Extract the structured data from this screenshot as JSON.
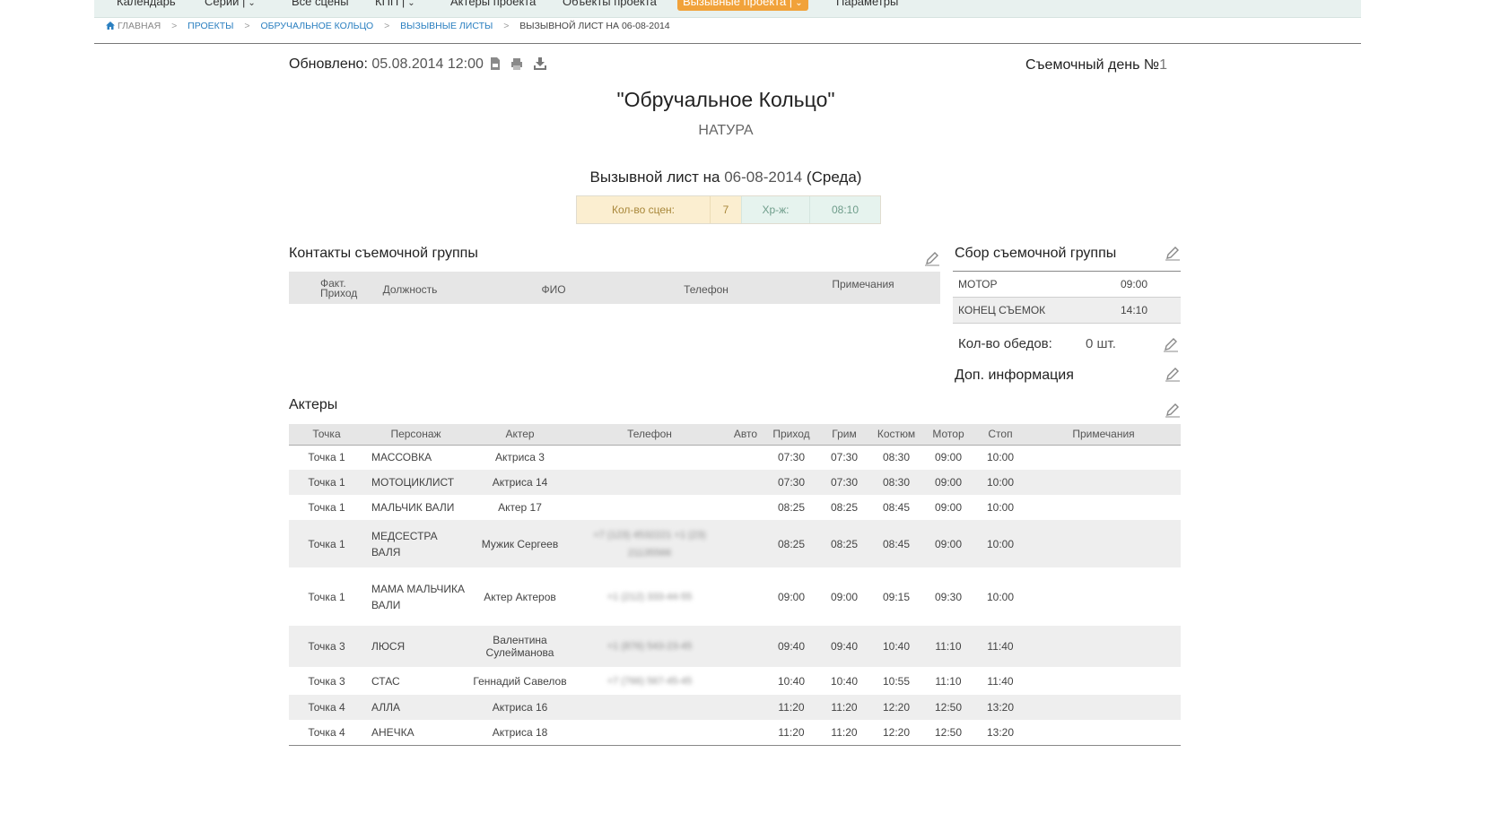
{
  "nav": [
    {
      "label": "Календарь",
      "chevron": false,
      "active": false
    },
    {
      "label": "Серии |",
      "chevron": true,
      "active": false
    },
    {
      "label": "Все сцены",
      "chevron": false,
      "active": false
    },
    {
      "label": "КПП |",
      "chevron": true,
      "active": false
    },
    {
      "label": "Актеры проекта",
      "chevron": false,
      "active": false
    },
    {
      "label": "Объекты проекта",
      "chevron": false,
      "active": false
    },
    {
      "label": "Вызывные проекта |",
      "chevron": true,
      "active": true
    },
    {
      "label": "Параметры",
      "chevron": false,
      "active": false
    }
  ],
  "breadcrumb": {
    "home": "ГЛАВНАЯ",
    "projects": "ПРОЕКТЫ",
    "project": "ОБРУЧАЛЬНОЕ КОЛЬЦО",
    "sheets": "ВЫЗЫВНЫЕ ЛИСТЫ",
    "current": "ВЫЗЫВНОЙ ЛИСТ НА 06-08-2014"
  },
  "header": {
    "updated_label": "Обновлено:",
    "updated_value": "05.08.2014 12:00",
    "shoot_day_label": "Съемочный день №",
    "shoot_day_num": "1",
    "project_title": "\"Обручальное Кольцо\"",
    "project_subtitle": "НАТУРА",
    "sheet_label": "Вызывной лист на",
    "sheet_date": "06-08-2014",
    "sheet_open_paren": "(",
    "sheet_day": "Среда",
    "sheet_close_paren": ")"
  },
  "stats": {
    "scenes_label": "Кол-во сцен:",
    "scenes_value": "7",
    "duration_label": "Хр-ж:",
    "duration_value": "08:10"
  },
  "contacts": {
    "title": "Контакты съемочной группы",
    "col_arrival_1": "Факт.",
    "col_arrival_2": "Приход",
    "col_position": "Должность",
    "col_name": "ФИО",
    "col_phone": "Телефон",
    "col_notes": "Примечания"
  },
  "crew_call": {
    "title": "Сбор съемочной группы",
    "rows": [
      {
        "label": "МОТОР",
        "time": "09:00"
      },
      {
        "label": "КОНЕЦ СЪЕМОК",
        "time": "14:10"
      }
    ],
    "lunch_label": "Кол-во обедов:",
    "lunch_value": "0 шт.",
    "extra_info": "Доп. информация"
  },
  "actors": {
    "title": "Актеры",
    "columns": [
      "Точка",
      "Персонаж",
      "Актер",
      "Телефон",
      "Авто",
      "Приход",
      "Грим",
      "Костюм",
      "Мотор",
      "Стоп",
      "Примечания"
    ],
    "rows": [
      {
        "point": "Точка 1",
        "character": "МАССОВКА",
        "actor": "Актриса 3",
        "phone": "",
        "car": "",
        "arrive": "07:30",
        "makeup": "07:30",
        "costume": "08:30",
        "motor": "09:00",
        "stop": "10:00",
        "notes": ""
      },
      {
        "point": "Точка 1",
        "character": "МОТОЦИКЛИСТ",
        "actor": "Актриса 14",
        "phone": "",
        "car": "",
        "arrive": "07:30",
        "makeup": "07:30",
        "costume": "08:30",
        "motor": "09:00",
        "stop": "10:00",
        "notes": ""
      },
      {
        "point": "Точка 1",
        "character": "МАЛЬЧИК ВАЛИ",
        "actor": "Актер 17",
        "phone": "",
        "car": "",
        "arrive": "08:25",
        "makeup": "08:25",
        "costume": "08:45",
        "motor": "09:00",
        "stop": "10:00",
        "notes": ""
      },
      {
        "point": "Точка 1",
        "character": "МЕДСЕСТРА ВАЛЯ",
        "actor": "Мужик Сергеев",
        "phone": "+7 (123) 4532221 +1 (23) 21135566",
        "car": "",
        "arrive": "08:25",
        "makeup": "08:25",
        "costume": "08:45",
        "motor": "09:00",
        "stop": "10:00",
        "notes": ""
      },
      {
        "point": "Точка 1",
        "character": "МАМА МАЛЬЧИКА ВАЛИ",
        "actor": "Актер Актеров",
        "phone": "+1 (212) 333-44-55",
        "car": "",
        "arrive": "09:00",
        "makeup": "09:00",
        "costume": "09:15",
        "motor": "09:30",
        "stop": "10:00",
        "notes": ""
      },
      {
        "point": "Точка 3",
        "character": "ЛЮСЯ",
        "actor": "Валентина Сулейманова",
        "phone": "+1 (876) 543-23-45",
        "car": "",
        "arrive": "09:40",
        "makeup": "09:40",
        "costume": "10:40",
        "motor": "11:10",
        "stop": "11:40",
        "notes": ""
      },
      {
        "point": "Точка 3",
        "character": "СТАС",
        "actor": "Геннадий Савелов",
        "phone": "+7 (766) 567-45-45",
        "car": "",
        "arrive": "10:40",
        "makeup": "10:40",
        "costume": "10:55",
        "motor": "11:10",
        "stop": "11:40",
        "notes": ""
      },
      {
        "point": "Точка 4",
        "character": "АЛЛА",
        "actor": "Актриса 16",
        "phone": "",
        "car": "",
        "arrive": "11:20",
        "makeup": "11:20",
        "costume": "12:20",
        "motor": "12:50",
        "stop": "13:20",
        "notes": ""
      },
      {
        "point": "Точка 4",
        "character": "АНЕЧКА",
        "actor": "Актриса 18",
        "phone": "",
        "car": "",
        "arrive": "11:20",
        "makeup": "11:20",
        "costume": "12:20",
        "motor": "12:50",
        "stop": "13:20",
        "notes": ""
      }
    ]
  },
  "colors": {
    "accent": "#f1a23a",
    "link": "#2a7fc0",
    "nav_bg": "#e8f1ef"
  }
}
